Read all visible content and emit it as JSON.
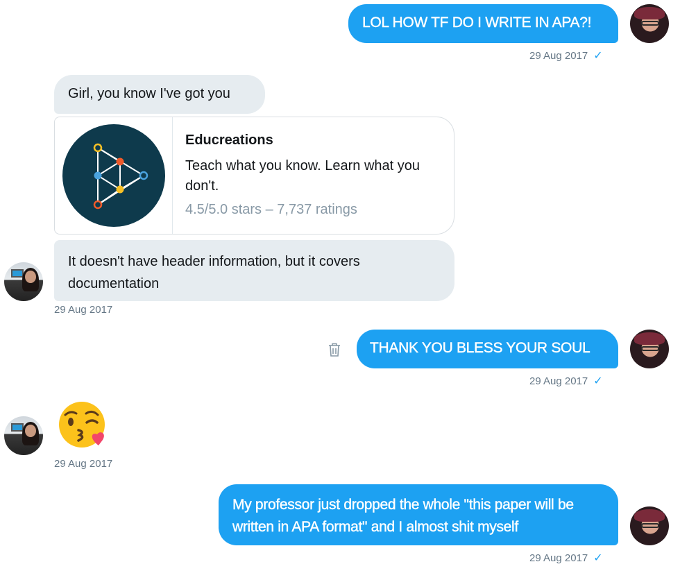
{
  "messages": {
    "m1": {
      "text": "LOL HOW TF DO I WRITE IN APA?!",
      "time": "29 Aug 2017",
      "check": "✓"
    },
    "m2": {
      "text": "Girl, you know I've got you"
    },
    "card": {
      "title": "Educreations",
      "description": "Teach what you know. Learn what you don't.",
      "rating": "4.5/5.0 stars – 7,737 ratings",
      "colors": {
        "bg": "#0e3a4c",
        "yellow": "#f6c026",
        "orange": "#ef5a2a",
        "blue": "#4aa3df"
      }
    },
    "m3": {
      "text": "It doesn't have header information, but it covers documentation",
      "time": "29 Aug 2017"
    },
    "m4": {
      "text": "THANK YOU BLESS YOUR SOUL",
      "time": "29 Aug 2017",
      "check": "✓"
    },
    "m5": {
      "emoji": "😘",
      "time": "29 Aug 2017"
    },
    "m6": {
      "text": "My professor just dropped the whole \"this paper will be written in APA format\" and I almost shit myself",
      "time": "29 Aug 2017",
      "check": "✓"
    }
  },
  "colors": {
    "outgoing": "#1da1f2",
    "incoming": "#e6ecf0",
    "timestamp": "#657786"
  }
}
